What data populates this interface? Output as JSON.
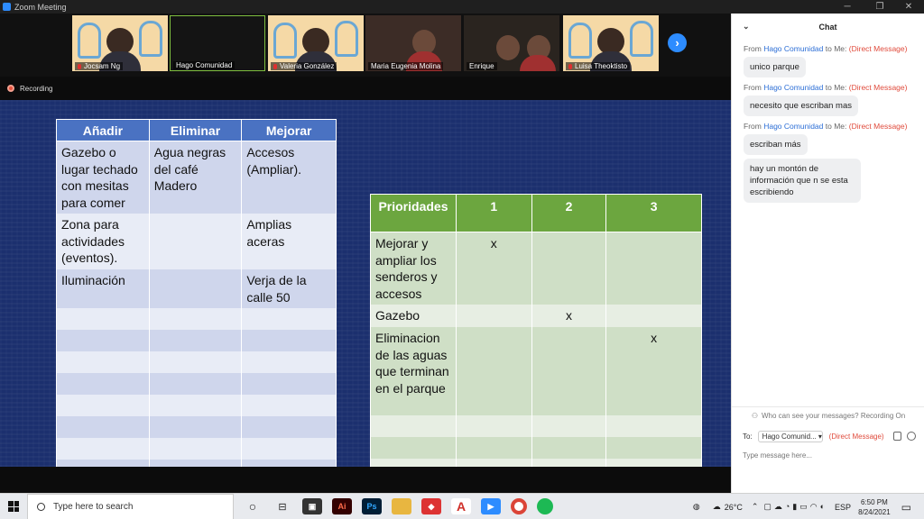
{
  "window": {
    "title": "Zoom Meeting",
    "minimize": "─",
    "maximize": "❐",
    "close": "✕"
  },
  "participants": [
    {
      "name": "Jocsam Ng"
    },
    {
      "name": "Hago Comunidad"
    },
    {
      "name": "Valeria González"
    },
    {
      "name": "Maria Eugenia Molina"
    },
    {
      "name": "Enrique"
    },
    {
      "name": "Luisa Theoktisto"
    }
  ],
  "recording": {
    "label": "Recording"
  },
  "slide": {
    "table1": {
      "headers": [
        "Añadir",
        "Eliminar",
        "Mejorar"
      ],
      "rows": [
        [
          "Gazebo o lugar techado con mesitas para comer",
          "Agua negras del café Madero",
          "Accesos (Ampliar)."
        ],
        [
          "Zona para actividades (eventos).",
          "",
          "Amplias aceras"
        ],
        [
          "Iluminación",
          "",
          "Verja de la calle 50"
        ]
      ]
    },
    "table2": {
      "headers": [
        "Prioridades",
        "1",
        "2",
        "3"
      ],
      "rows": [
        [
          "Mejorar y ampliar los senderos y accesos",
          "x",
          "",
          ""
        ],
        [
          "Gazebo",
          "",
          "x",
          ""
        ],
        [
          "Eliminacion de las aguas que terminan en el parque",
          "",
          "",
          "x"
        ]
      ]
    }
  },
  "chat": {
    "title": "Chat",
    "messages": [
      {
        "from_label": "From",
        "sender": "Hago Comunidad",
        "to": "to Me:",
        "dm": "(Direct Message)",
        "texts": [
          "unico parque"
        ]
      },
      {
        "from_label": "From",
        "sender": "Hago Comunidad",
        "to": "to Me:",
        "dm": "(Direct Message)",
        "texts": [
          "necesito que escriban mas"
        ]
      },
      {
        "from_label": "From",
        "sender": "Hago Comunidad",
        "to": "to Me:",
        "dm": "(Direct Message)",
        "texts": [
          "escriban más",
          "hay un montón de información que n se esta escribiendo"
        ]
      }
    ],
    "who_can_see": "Who can see your messages? Recording On",
    "to_label": "To:",
    "to_value": "Hago Comunid...",
    "to_dm": "(Direct Message)",
    "input_placeholder": "Type message here..."
  },
  "taskbar": {
    "search_placeholder": "Type here to search",
    "weather": "26°C",
    "language": "ESP",
    "time": "6:50 PM",
    "date": "8/24/2021"
  },
  "colors": {
    "slide_bg": "#1b2f6e",
    "table1_header": "#4a72c2",
    "table2_header": "#6ca63f",
    "zoom_blue": "#2d8cff",
    "dm_red": "#e04b3c"
  }
}
